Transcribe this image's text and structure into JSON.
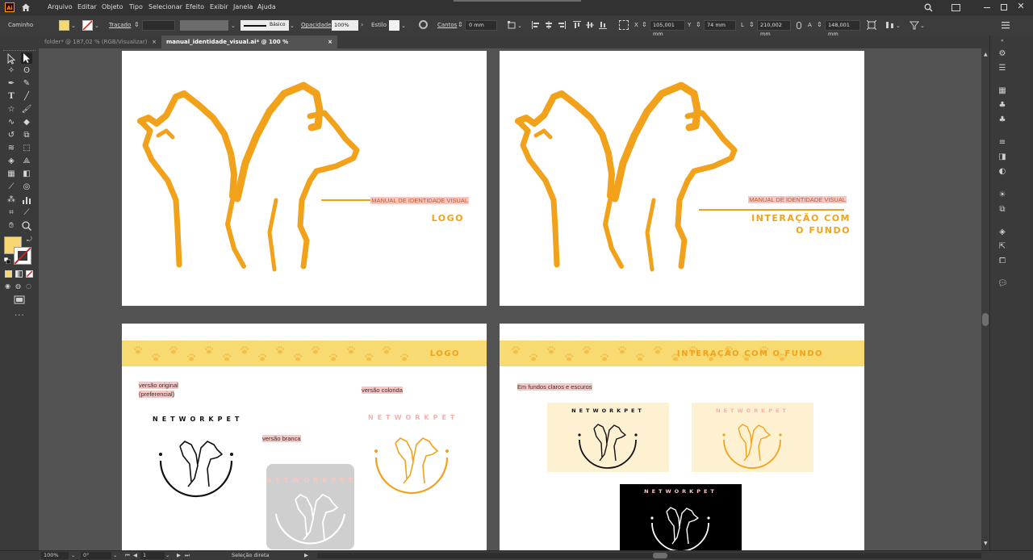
{
  "app": {
    "logo": "Ai",
    "home_icon": "home-icon"
  },
  "menu": [
    "Arquivo",
    "Editar",
    "Objeto",
    "Tipo",
    "Selecionar",
    "Efeito",
    "Exibir",
    "Janela",
    "Ajuda"
  ],
  "control_bar": {
    "selection_label": "Caminho",
    "stroke_label": "Traçado",
    "brush_label": "Básico",
    "opacity_label": "Opacidade",
    "opacity_value": "100%",
    "style_label": "Estilo",
    "corners_label": "Cantos",
    "corners_value": "0 mm",
    "x_label": "X",
    "x_value": "105,001 mm",
    "y_label": "Y",
    "y_value": "74 mm",
    "w_label": "L",
    "w_value": "210,002 mm",
    "h_label": "A",
    "h_value": "148,001 mm",
    "fill_color": "#f7d774"
  },
  "tabs": [
    {
      "label": "folder* @ 187,02 % (RGB/Visualizar)",
      "close": "×"
    },
    {
      "label": "manual_identidade_visual.ai* @ 100 % (RGB/Visualizar)",
      "close": "×"
    }
  ],
  "artboards": {
    "cover_logo": {
      "subtitle": "MANUAL DE IDENTIDADE VISUAL",
      "title": "LOGO"
    },
    "cover_bg": {
      "subtitle": "MANUAL DE IDENTIDADE VISUAL",
      "title_line1": "INTERAÇÃO COM",
      "title_line2": "O FUNDO"
    },
    "logo_page": {
      "banner": "LOGO",
      "label_original": "versão original\n(preferencial)",
      "label_original_1": "versão original",
      "label_original_2": "(preferencial)",
      "label_white": "versão branca",
      "label_color": "versão colorida",
      "brand": "NETWORKPET"
    },
    "bg_page": {
      "banner": "INTERAÇÃO COM O FUNDO",
      "label": "Em fundos claros e escuros",
      "brand": "NETWORKPET"
    }
  },
  "colors": {
    "orange": "#f2a21a",
    "banner_yellow": "#f7db72",
    "pink_highlight": "#f6c7c4",
    "cream": "#fdf1d2"
  },
  "status": {
    "zoom": "100%",
    "rotation": "0°",
    "artboard_number": "1",
    "tool_name": "Seleção direta"
  }
}
